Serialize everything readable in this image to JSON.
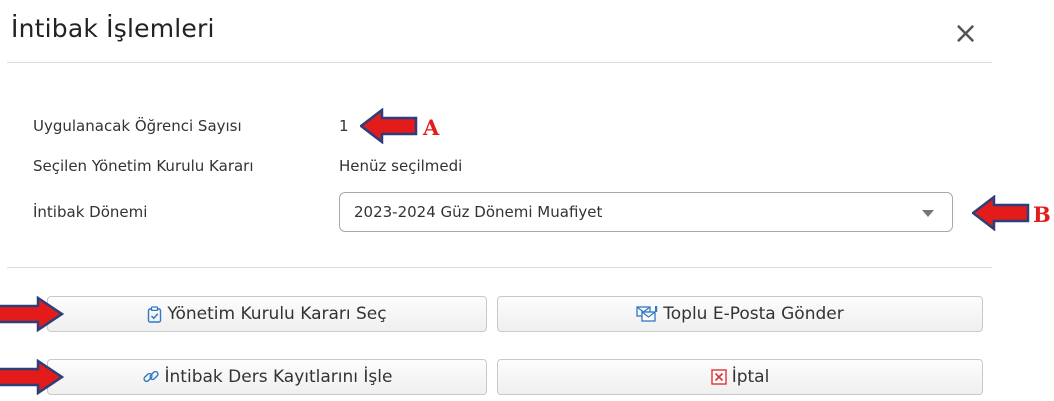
{
  "dialog": {
    "title": "İntibak İşlemleri",
    "close_icon": "close-icon"
  },
  "fields": {
    "student_count_label": "Uygulanacak Öğrenci Sayısı",
    "student_count_value": "1",
    "board_decision_label": "Seçilen Yönetim Kurulu Kararı",
    "board_decision_value": "Henüz seçilmedi",
    "period_label": "İntibak Dönemi",
    "period_selected": "2023-2024 Güz Dönemi Muafiyet"
  },
  "buttons": {
    "select_decision": "Yönetim Kurulu Kararı Seç",
    "send_email": "Toplu E-Posta Gönder",
    "process_records": "İntibak Ders Kayıtlarını İşle",
    "cancel": "İptal"
  },
  "annotations": {
    "marker_a": "A",
    "marker_b": "B",
    "arrow_color": "#e31b1b",
    "arrow_outline": "#2b3f7a"
  },
  "icons": [
    "clipboard-check-icon",
    "email-group-icon",
    "link-icon",
    "close-box-icon",
    "chevron-down-icon"
  ]
}
